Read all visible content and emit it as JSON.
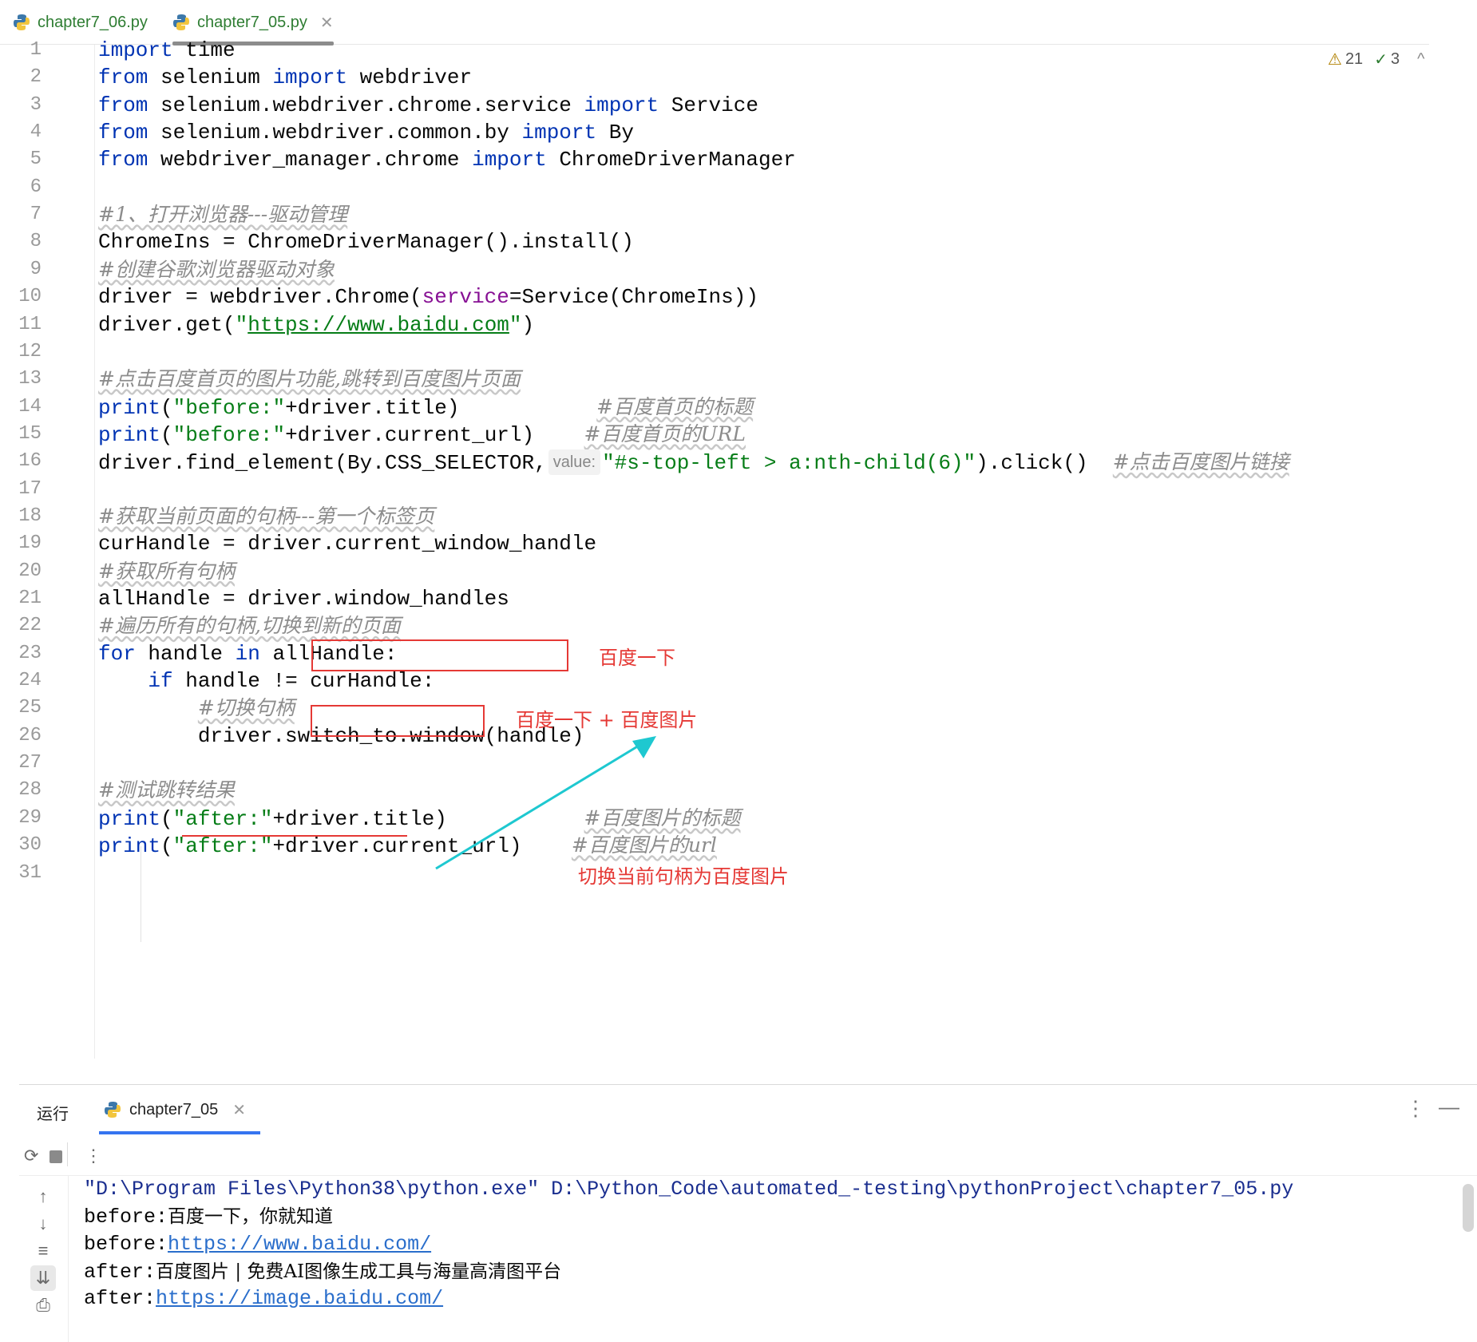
{
  "tabs": [
    {
      "label": "chapter7_06.py",
      "active": false
    },
    {
      "label": "chapter7_05.py",
      "active": true
    }
  ],
  "inspections": {
    "warnings": "21",
    "ok": "3"
  },
  "code_lines": [
    {
      "n": "1",
      "html": "<span class=\"kw\">import</span> time"
    },
    {
      "n": "2",
      "html": "<span class=\"kw\">from</span> selenium <span class=\"kw\">import</span> webdriver"
    },
    {
      "n": "3",
      "html": "<span class=\"kw\">from</span> selenium.webdriver.chrome.service <span class=\"kw\">import</span> Service"
    },
    {
      "n": "4",
      "html": "<span class=\"kw\">from</span> selenium.webdriver.common.by <span class=\"kw\">import</span> By"
    },
    {
      "n": "5",
      "html": "<span class=\"kw\">from</span> webdriver_manager.chrome <span class=\"kw\">import</span> ChromeDriverManager"
    },
    {
      "n": "6",
      "html": ""
    },
    {
      "n": "7",
      "html": "<span class=\"cmt\">#1、打开浏览器---驱动管理</span>"
    },
    {
      "n": "8",
      "html": "ChromeIns = ChromeDriverManager().install()"
    },
    {
      "n": "9",
      "html": "<span class=\"cmt\">#创建谷歌浏览器驱动对象</span>"
    },
    {
      "n": "10",
      "html": "driver = webdriver.Chrome(<span class=\"param\">service</span>=Service(ChromeIns))"
    },
    {
      "n": "11",
      "html": "driver.get(<span class=\"str\">\"</span><span class=\"url\">https://www.baidu.com</span><span class=\"str\">\"</span>)"
    },
    {
      "n": "12",
      "html": ""
    },
    {
      "n": "13",
      "html": "<span class=\"cmt\">#点击百度首页的图片功能,跳转到百度图片页面</span>"
    },
    {
      "n": "14",
      "html": "<span class=\"kw\">print</span>(<span class=\"str\">\"before:\"</span>+driver.title)           <span class=\"cmt\">#百度首页的标题</span>"
    },
    {
      "n": "15",
      "html": "<span class=\"kw\">print</span>(<span class=\"str\">\"before:\"</span>+driver.current_url)    <span class=\"cmt\">#百度首页的URL</span>"
    },
    {
      "n": "16",
      "html": "driver.find_element(By.CSS_SELECTOR,<span class=\"hint\">value:</span><span class=\"str\">\"#s-top-left &gt; a:nth-child(6)\"</span>).click()  <span class=\"cmt\">#点击百度图片链接</span>"
    },
    {
      "n": "17",
      "html": ""
    },
    {
      "n": "18",
      "html": "<span class=\"cmt\">#获取当前页面的句柄---第一个标签页</span>"
    },
    {
      "n": "19",
      "html": "curHandle = driver.current_window_handle"
    },
    {
      "n": "20",
      "html": "<span class=\"cmt\">#获取所有句柄</span>"
    },
    {
      "n": "21",
      "html": "allHandle = driver.window_handles"
    },
    {
      "n": "22",
      "html": "<span class=\"cmt\">#遍历所有的句柄,切换到新的页面</span>"
    },
    {
      "n": "23",
      "html": "<span class=\"kw\">for</span> handle <span class=\"kw\">in</span> allHandle:"
    },
    {
      "n": "24",
      "html": "    <span class=\"kw\">if</span> handle != curHandle:"
    },
    {
      "n": "25",
      "html": "        <span class=\"cmt\">#切换句柄</span>"
    },
    {
      "n": "26",
      "html": "        driver.switch_to.window(handle)"
    },
    {
      "n": "27",
      "html": ""
    },
    {
      "n": "28",
      "html": "<span class=\"cmt\">#测试跳转结果</span>"
    },
    {
      "n": "29",
      "html": "<span class=\"kw\">print</span>(<span class=\"str\">\"after:\"</span>+driver.title)           <span class=\"cmt\">#百度图片的标题</span>"
    },
    {
      "n": "30",
      "html": "<span class=\"kw\">print</span>(<span class=\"str\">\"after:\"</span>+driver.current_url)    <span class=\"cmt\">#百度图片的url</span>"
    },
    {
      "n": "31",
      "html": ""
    }
  ],
  "annotations": {
    "note1": "百度一下",
    "note2": "百度一下 + 百度图片",
    "note3": "切换当前句柄为百度图片",
    "box_color": "#e53935",
    "arrow_color": "#1ec8d0"
  },
  "run_panel": {
    "label": "运行",
    "tab_label": "chapter7_05",
    "console_lines": [
      {
        "html": "<span class=\"cmd\">\"D:\\Program Files\\Python38\\python.exe\" D:\\Python_Code\\automated_-testing\\pythonProject\\chapter7_05.py</span>"
      },
      {
        "html": "before:<span class=\"cn\">百度一下，你就知道</span>"
      },
      {
        "html": "before:<a>https://www.baidu.com/</a>"
      },
      {
        "html": "after:<span class=\"cn\">百度图片 | 免费AI图像生成工具与海量高清图平台</span>"
      },
      {
        "html": "after:<a>https://image.baidu.com/</a>"
      }
    ]
  },
  "icons": {
    "tab_file": "python-file-icon",
    "warning": "warning-icon",
    "check": "check-icon",
    "rerun": "rerun-icon",
    "stop": "stop-icon",
    "up": "arrow-up-icon",
    "down": "arrow-down-icon",
    "wrap": "soft-wrap-icon",
    "scroll_end": "scroll-to-end-icon",
    "print": "print-icon"
  }
}
